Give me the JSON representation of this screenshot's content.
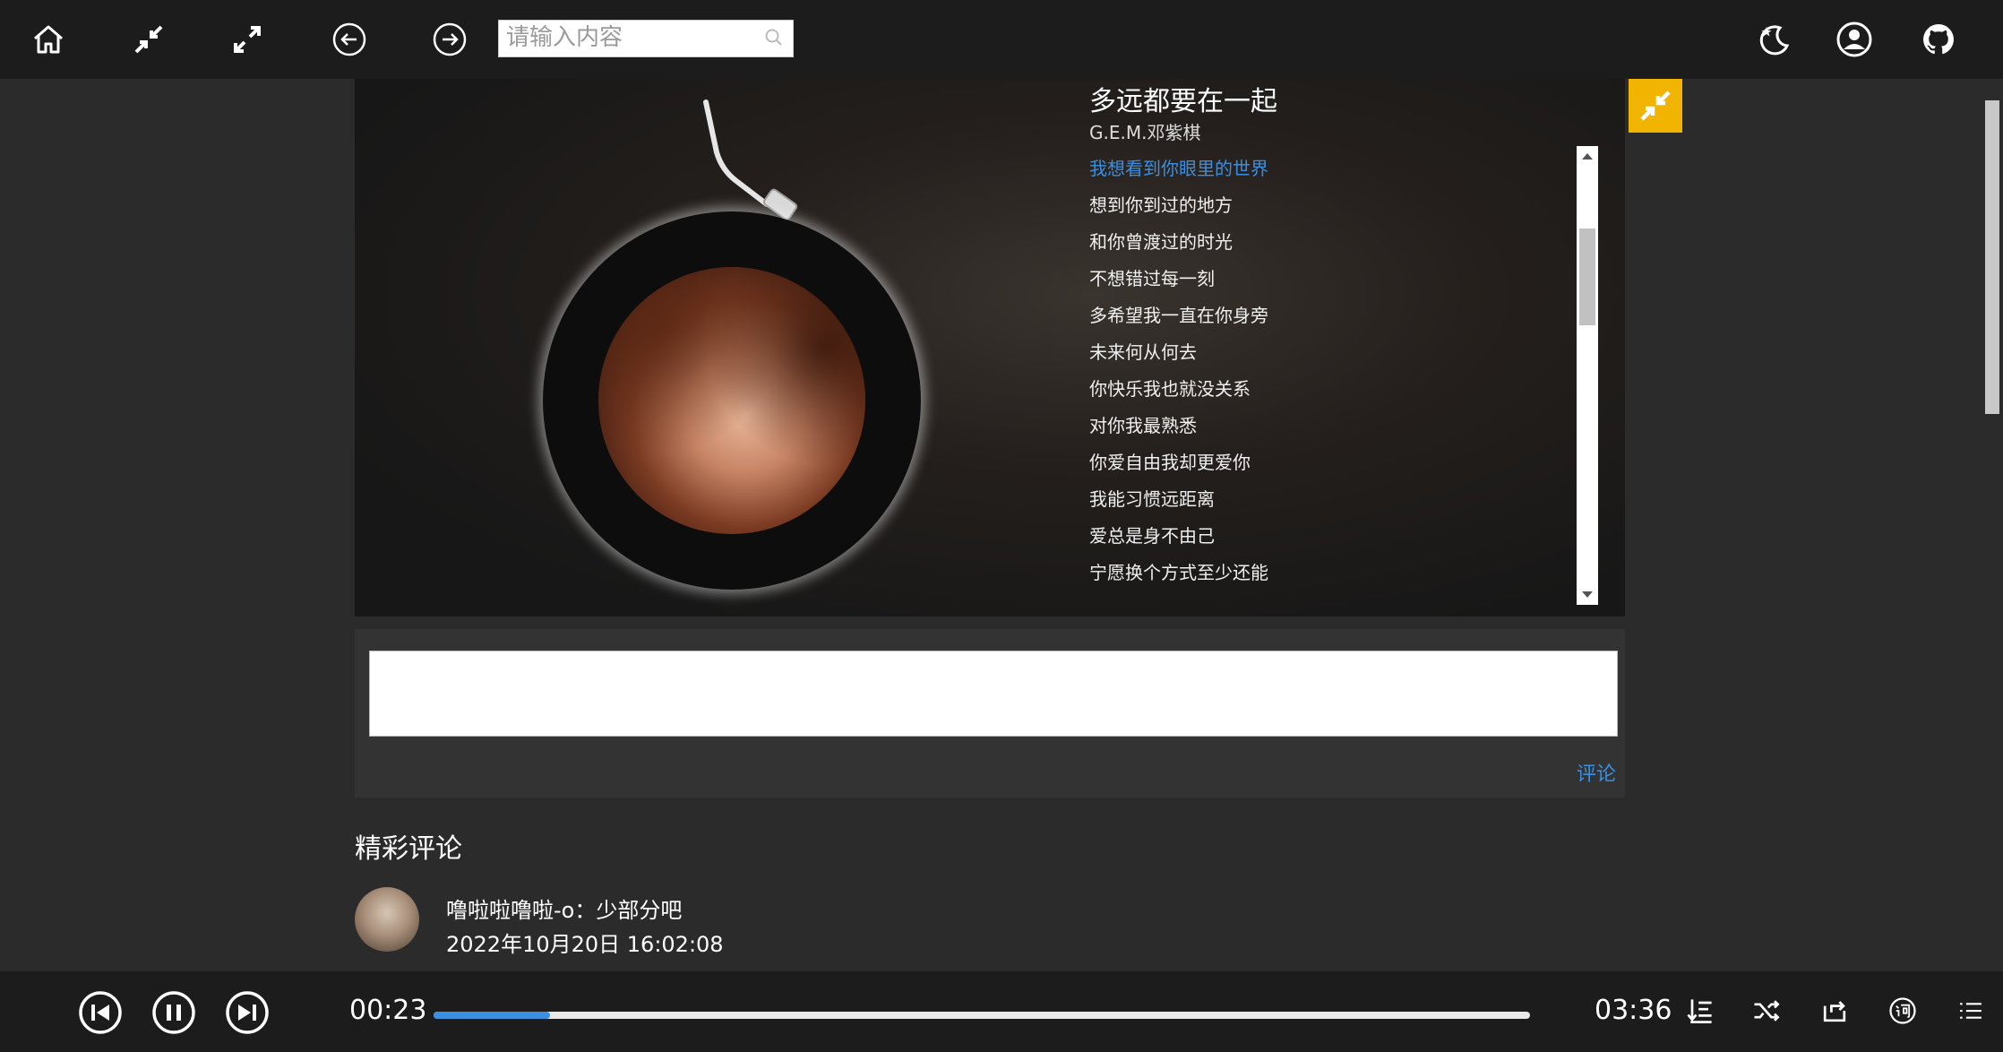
{
  "topbar": {
    "icons": [
      "home-icon",
      "shrink-icon",
      "expand-icon",
      "back-icon",
      "forward-icon",
      "night-mode-icon",
      "user-icon",
      "github-icon"
    ],
    "search_placeholder": "请输入内容"
  },
  "song": {
    "title": "多远都要在一起",
    "artist": "G.E.M.邓紫棋"
  },
  "lyrics": [
    "我想看到你眼里的世界",
    "想到你到过的地方",
    "和你曾渡过的时光",
    "不想错过每一刻",
    "多希望我一直在你身旁",
    "未来何从何去",
    "你快乐我也就没关系",
    "对你我最熟悉",
    "你爱自由我却更爱你",
    "我能习惯远距离",
    "爱总是身不由己",
    "宁愿换个方式至少还能"
  ],
  "active_lyric_index": 0,
  "comment_form": {
    "submit_label": "评论"
  },
  "comments_section": {
    "title": "精彩评论",
    "items": [
      {
        "user_and_text": "噜啦啦噜啦-o：少部分吧",
        "time": "2022年10月20日 16:02:08"
      }
    ]
  },
  "player": {
    "current_time": "00:23",
    "total_time": "03:36",
    "progress_fraction": 0.106
  },
  "colors": {
    "accent": "#3a8fe0",
    "shrink_button": "#f1b400",
    "bar_bg": "#1c1c1c",
    "page_bg": "#2b2b2b"
  }
}
